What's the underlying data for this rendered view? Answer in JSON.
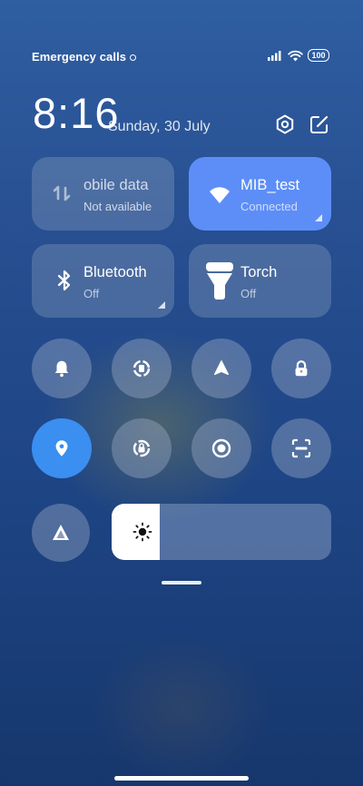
{
  "status_bar": {
    "carrier_text": "Emergency calls",
    "battery": "100",
    "icons": [
      "signal-icon",
      "wifi-icon",
      "battery-icon"
    ]
  },
  "header": {
    "time": "8:16",
    "date": "Sunday, 30 July",
    "icons": [
      "settings-icon",
      "edit-icon"
    ]
  },
  "tiles": {
    "mobile_data": {
      "title": "obile data",
      "status": "Not available",
      "on": false
    },
    "wifi": {
      "title": "MIB_test",
      "status": "Connected",
      "on": true
    },
    "bluetooth": {
      "title": "Bluetooth",
      "status": "Off",
      "on": false
    },
    "torch": {
      "title": "Torch",
      "status": "Off",
      "on": false
    }
  },
  "toggles_row1": [
    "bell-icon",
    "auto-rotate-icon",
    "airplane-icon",
    "lock-icon"
  ],
  "toggles_row2": [
    "location-icon",
    "rotation-lock-icon",
    "screen-record-icon",
    "screenshot-icon"
  ],
  "location_on": true,
  "brightness": {
    "level_fraction": 0.22,
    "icon": "sun-icon",
    "auto_icon": "auto-brightness-icon"
  },
  "colors": {
    "accent": "#5d8ef7",
    "location_active": "#3a8ff0",
    "background_top": "#2f5ea1",
    "background_bottom": "#16376d"
  }
}
